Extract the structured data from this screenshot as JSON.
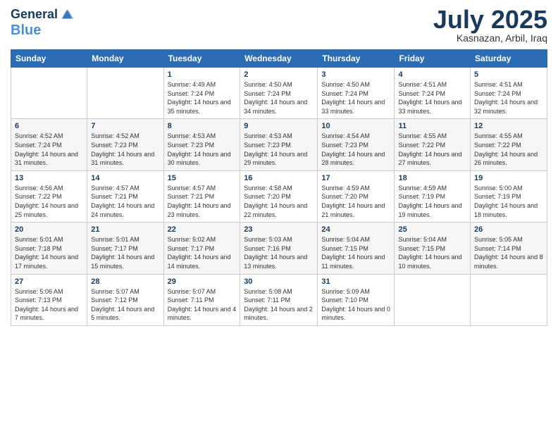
{
  "header": {
    "logo_line1": "General",
    "logo_line2": "Blue",
    "month": "July 2025",
    "location": "Kasnazan, Arbil, Iraq"
  },
  "weekdays": [
    "Sunday",
    "Monday",
    "Tuesday",
    "Wednesday",
    "Thursday",
    "Friday",
    "Saturday"
  ],
  "weeks": [
    [
      {
        "day": "",
        "sunrise": "",
        "sunset": "",
        "daylight": ""
      },
      {
        "day": "",
        "sunrise": "",
        "sunset": "",
        "daylight": ""
      },
      {
        "day": "1",
        "sunrise": "Sunrise: 4:49 AM",
        "sunset": "Sunset: 7:24 PM",
        "daylight": "Daylight: 14 hours and 35 minutes."
      },
      {
        "day": "2",
        "sunrise": "Sunrise: 4:50 AM",
        "sunset": "Sunset: 7:24 PM",
        "daylight": "Daylight: 14 hours and 34 minutes."
      },
      {
        "day": "3",
        "sunrise": "Sunrise: 4:50 AM",
        "sunset": "Sunset: 7:24 PM",
        "daylight": "Daylight: 14 hours and 33 minutes."
      },
      {
        "day": "4",
        "sunrise": "Sunrise: 4:51 AM",
        "sunset": "Sunset: 7:24 PM",
        "daylight": "Daylight: 14 hours and 33 minutes."
      },
      {
        "day": "5",
        "sunrise": "Sunrise: 4:51 AM",
        "sunset": "Sunset: 7:24 PM",
        "daylight": "Daylight: 14 hours and 32 minutes."
      }
    ],
    [
      {
        "day": "6",
        "sunrise": "Sunrise: 4:52 AM",
        "sunset": "Sunset: 7:24 PM",
        "daylight": "Daylight: 14 hours and 31 minutes."
      },
      {
        "day": "7",
        "sunrise": "Sunrise: 4:52 AM",
        "sunset": "Sunset: 7:23 PM",
        "daylight": "Daylight: 14 hours and 31 minutes."
      },
      {
        "day": "8",
        "sunrise": "Sunrise: 4:53 AM",
        "sunset": "Sunset: 7:23 PM",
        "daylight": "Daylight: 14 hours and 30 minutes."
      },
      {
        "day": "9",
        "sunrise": "Sunrise: 4:53 AM",
        "sunset": "Sunset: 7:23 PM",
        "daylight": "Daylight: 14 hours and 29 minutes."
      },
      {
        "day": "10",
        "sunrise": "Sunrise: 4:54 AM",
        "sunset": "Sunset: 7:23 PM",
        "daylight": "Daylight: 14 hours and 28 minutes."
      },
      {
        "day": "11",
        "sunrise": "Sunrise: 4:55 AM",
        "sunset": "Sunset: 7:22 PM",
        "daylight": "Daylight: 14 hours and 27 minutes."
      },
      {
        "day": "12",
        "sunrise": "Sunrise: 4:55 AM",
        "sunset": "Sunset: 7:22 PM",
        "daylight": "Daylight: 14 hours and 26 minutes."
      }
    ],
    [
      {
        "day": "13",
        "sunrise": "Sunrise: 4:56 AM",
        "sunset": "Sunset: 7:22 PM",
        "daylight": "Daylight: 14 hours and 25 minutes."
      },
      {
        "day": "14",
        "sunrise": "Sunrise: 4:57 AM",
        "sunset": "Sunset: 7:21 PM",
        "daylight": "Daylight: 14 hours and 24 minutes."
      },
      {
        "day": "15",
        "sunrise": "Sunrise: 4:57 AM",
        "sunset": "Sunset: 7:21 PM",
        "daylight": "Daylight: 14 hours and 23 minutes."
      },
      {
        "day": "16",
        "sunrise": "Sunrise: 4:58 AM",
        "sunset": "Sunset: 7:20 PM",
        "daylight": "Daylight: 14 hours and 22 minutes."
      },
      {
        "day": "17",
        "sunrise": "Sunrise: 4:59 AM",
        "sunset": "Sunset: 7:20 PM",
        "daylight": "Daylight: 14 hours and 21 minutes."
      },
      {
        "day": "18",
        "sunrise": "Sunrise: 4:59 AM",
        "sunset": "Sunset: 7:19 PM",
        "daylight": "Daylight: 14 hours and 19 minutes."
      },
      {
        "day": "19",
        "sunrise": "Sunrise: 5:00 AM",
        "sunset": "Sunset: 7:19 PM",
        "daylight": "Daylight: 14 hours and 18 minutes."
      }
    ],
    [
      {
        "day": "20",
        "sunrise": "Sunrise: 5:01 AM",
        "sunset": "Sunset: 7:18 PM",
        "daylight": "Daylight: 14 hours and 17 minutes."
      },
      {
        "day": "21",
        "sunrise": "Sunrise: 5:01 AM",
        "sunset": "Sunset: 7:17 PM",
        "daylight": "Daylight: 14 hours and 15 minutes."
      },
      {
        "day": "22",
        "sunrise": "Sunrise: 5:02 AM",
        "sunset": "Sunset: 7:17 PM",
        "daylight": "Daylight: 14 hours and 14 minutes."
      },
      {
        "day": "23",
        "sunrise": "Sunrise: 5:03 AM",
        "sunset": "Sunset: 7:16 PM",
        "daylight": "Daylight: 14 hours and 13 minutes."
      },
      {
        "day": "24",
        "sunrise": "Sunrise: 5:04 AM",
        "sunset": "Sunset: 7:15 PM",
        "daylight": "Daylight: 14 hours and 11 minutes."
      },
      {
        "day": "25",
        "sunrise": "Sunrise: 5:04 AM",
        "sunset": "Sunset: 7:15 PM",
        "daylight": "Daylight: 14 hours and 10 minutes."
      },
      {
        "day": "26",
        "sunrise": "Sunrise: 5:05 AM",
        "sunset": "Sunset: 7:14 PM",
        "daylight": "Daylight: 14 hours and 8 minutes."
      }
    ],
    [
      {
        "day": "27",
        "sunrise": "Sunrise: 5:06 AM",
        "sunset": "Sunset: 7:13 PM",
        "daylight": "Daylight: 14 hours and 7 minutes."
      },
      {
        "day": "28",
        "sunrise": "Sunrise: 5:07 AM",
        "sunset": "Sunset: 7:12 PM",
        "daylight": "Daylight: 14 hours and 5 minutes."
      },
      {
        "day": "29",
        "sunrise": "Sunrise: 5:07 AM",
        "sunset": "Sunset: 7:11 PM",
        "daylight": "Daylight: 14 hours and 4 minutes."
      },
      {
        "day": "30",
        "sunrise": "Sunrise: 5:08 AM",
        "sunset": "Sunset: 7:11 PM",
        "daylight": "Daylight: 14 hours and 2 minutes."
      },
      {
        "day": "31",
        "sunrise": "Sunrise: 5:09 AM",
        "sunset": "Sunset: 7:10 PM",
        "daylight": "Daylight: 14 hours and 0 minutes."
      },
      {
        "day": "",
        "sunrise": "",
        "sunset": "",
        "daylight": ""
      },
      {
        "day": "",
        "sunrise": "",
        "sunset": "",
        "daylight": ""
      }
    ]
  ]
}
